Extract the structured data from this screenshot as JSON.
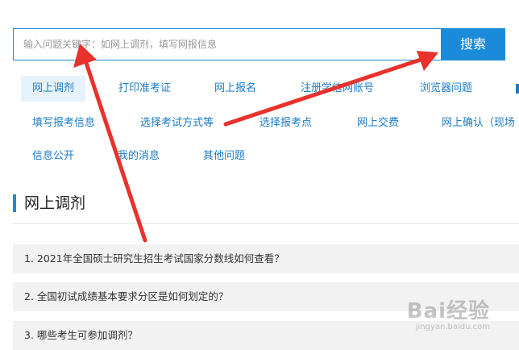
{
  "search": {
    "placeholder": "输入问题关键字：如网上调剂，填写网报信息",
    "button_label": "搜索"
  },
  "categories": [
    {
      "label": "网上调剂",
      "active": true
    },
    {
      "label": "打印准考证"
    },
    {
      "label": "网上报名"
    },
    {
      "label": "注册学信网账号"
    },
    {
      "label": "浏览器问题"
    },
    {
      "label": "填写报考信息"
    },
    {
      "label": "选择考试方式等"
    },
    {
      "label": "选择报考点"
    },
    {
      "label": "网上交费"
    },
    {
      "label": "网上确认（现场"
    },
    {
      "label": "信息公开"
    },
    {
      "label": "我的消息"
    },
    {
      "label": "其他问题"
    }
  ],
  "section": {
    "title": "网上调剂"
  },
  "questions": [
    {
      "text": "1. 2021年全国硕士研究生招生考试国家分数线如何查看？"
    },
    {
      "text": "2. 全国初试成绩基本要求分区是如何划定的？"
    },
    {
      "text": "3. 哪些考生可参加调剂？"
    }
  ],
  "colors": {
    "accent": "#1b8bd9",
    "annotation_arrow": "#e8322c"
  },
  "watermark": {
    "logo": "Bai经验",
    "url": "jingyan.baidu.com"
  }
}
